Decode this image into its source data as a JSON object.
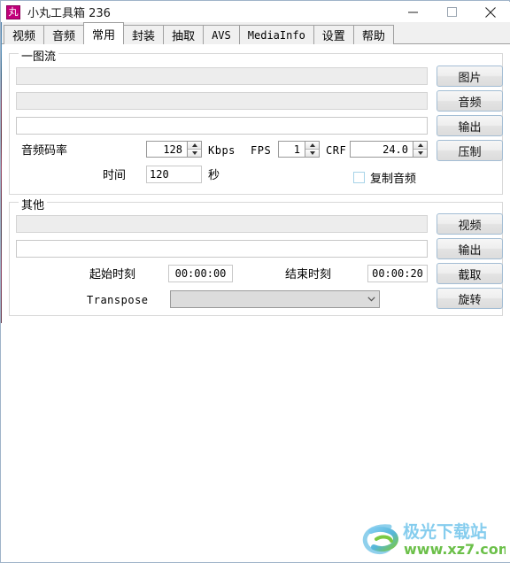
{
  "window": {
    "title": "小丸工具箱 236",
    "icon_glyph": "丸",
    "icon_color": "#c2007b",
    "controls": {
      "minimize": "minimize-icon",
      "maximize": "maximize-icon",
      "close": "close-icon"
    }
  },
  "tabs": [
    {
      "label": "视频",
      "active": false,
      "mono": false
    },
    {
      "label": "音频",
      "active": false,
      "mono": false
    },
    {
      "label": "常用",
      "active": true,
      "mono": false
    },
    {
      "label": "封装",
      "active": false,
      "mono": false
    },
    {
      "label": "抽取",
      "active": false,
      "mono": false
    },
    {
      "label": "AVS",
      "active": false,
      "mono": true
    },
    {
      "label": "MediaInfo",
      "active": false,
      "mono": true
    },
    {
      "label": "设置",
      "active": false,
      "mono": false
    },
    {
      "label": "帮助",
      "active": false,
      "mono": false
    }
  ],
  "group_image_stream": {
    "title": "一图流",
    "image_path": "",
    "audio_path": "",
    "output_path": "",
    "buttons": {
      "image": "图片",
      "audio": "音频",
      "output": "输出",
      "encode": "压制"
    },
    "audio_bitrate_label": "音频码率",
    "audio_bitrate_value": "128",
    "audio_bitrate_unit": "Kbps",
    "fps_label": "FPS",
    "fps_value": "1",
    "crf_label": "CRF",
    "crf_value": "24.0",
    "duration_label": "时间",
    "duration_value": "120",
    "duration_unit": "秒",
    "copy_audio_label": "复制音频",
    "copy_audio_checked": false
  },
  "group_other": {
    "title": "其他",
    "video_path": "",
    "output_path": "",
    "buttons": {
      "video": "视频",
      "output": "输出",
      "cut": "截取",
      "rotate": "旋转"
    },
    "start_time_label": "起始时刻",
    "start_time_value": "00:00:00",
    "end_time_label": "结束时刻",
    "end_time_value": "00:00:20",
    "transpose_label": "Transpose",
    "transpose_value": ""
  },
  "watermark": {
    "text_cn": "极光下载站",
    "text_url": "www.xz7.com",
    "color_cn": "#7ec8e3",
    "color_url": "#6cc04a"
  }
}
